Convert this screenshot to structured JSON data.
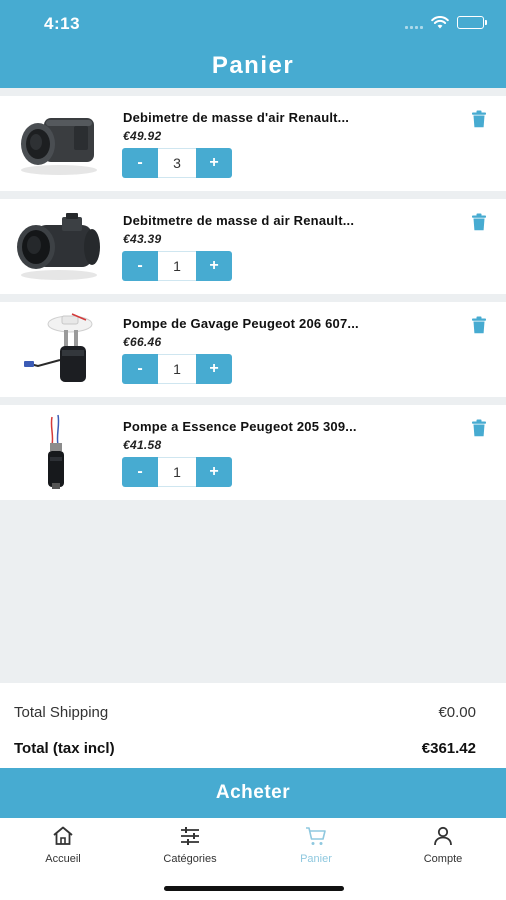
{
  "status_bar": {
    "time": "4:13"
  },
  "header": {
    "title": "Panier"
  },
  "cart": {
    "items": [
      {
        "name": "Debimetre de masse d'air Renault...",
        "price": "€49.92",
        "quantity": "3",
        "minus": "-",
        "plus": "+"
      },
      {
        "name": "Debitmetre de masse d air Renault...",
        "price": "€43.39",
        "quantity": "1",
        "minus": "-",
        "plus": "+"
      },
      {
        "name": "Pompe de Gavage Peugeot 206 607...",
        "price": "€66.46",
        "quantity": "1",
        "minus": "-",
        "plus": "+"
      },
      {
        "name": "Pompe a Essence Peugeot 205 309...",
        "price": "€41.58",
        "quantity": "1",
        "minus": "-",
        "plus": "+"
      }
    ]
  },
  "totals": {
    "shipping_label": "Total Shipping",
    "shipping_value": "€0.00",
    "total_label": "Total (tax incl)",
    "total_value": "€361.42"
  },
  "buy_button": {
    "label": "Acheter"
  },
  "bottom_nav": {
    "items": [
      {
        "label": "Accueil",
        "icon": "home-icon",
        "active": false
      },
      {
        "label": "Catégories",
        "icon": "sliders-icon",
        "active": false
      },
      {
        "label": "Panier",
        "icon": "cart-icon",
        "active": true
      },
      {
        "label": "Compte",
        "icon": "user-icon",
        "active": false
      }
    ]
  },
  "colors": {
    "primary": "#47abd1",
    "background": "#eceff1",
    "active_tab": "#8fc8df"
  }
}
